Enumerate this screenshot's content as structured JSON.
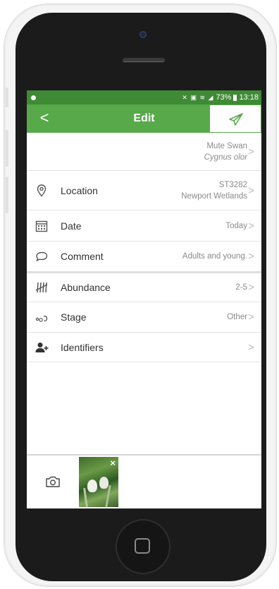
{
  "status_bar": {
    "battery": "73%",
    "time": "13:18"
  },
  "app_bar": {
    "back": "<",
    "title": "Edit"
  },
  "species": {
    "common_name": "Mute Swan",
    "latin_name": "Cygnus olor"
  },
  "fields": {
    "location": {
      "label": "Location",
      "value_line1": "ST3282",
      "value_line2": "Newport Wetlands"
    },
    "date": {
      "label": "Date",
      "value": "Today"
    },
    "comment": {
      "label": "Comment",
      "value": "Adults and young."
    },
    "abundance": {
      "label": "Abundance",
      "value": "2-5"
    },
    "stage": {
      "label": "Stage",
      "value": "Other"
    },
    "identifiers": {
      "label": "Identifiers",
      "value": ""
    }
  },
  "chevron": ">",
  "photo": {
    "close": "×"
  },
  "colors": {
    "status_green": "#3f8a35",
    "header_green": "#57a94a"
  }
}
